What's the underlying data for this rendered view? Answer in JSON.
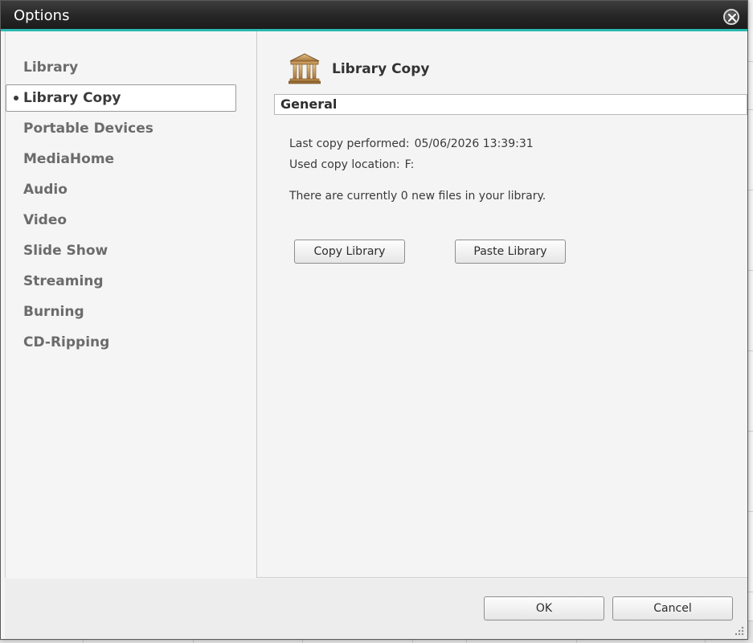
{
  "window": {
    "title": "Options"
  },
  "sidebar": {
    "items": [
      {
        "label": "Library",
        "selected": false
      },
      {
        "label": "Library Copy",
        "selected": true
      },
      {
        "label": "Portable Devices",
        "selected": false
      },
      {
        "label": "MediaHome",
        "selected": false
      },
      {
        "label": "Audio",
        "selected": false
      },
      {
        "label": "Video",
        "selected": false
      },
      {
        "label": "Slide Show",
        "selected": false
      },
      {
        "label": "Streaming",
        "selected": false
      },
      {
        "label": "Burning",
        "selected": false
      },
      {
        "label": "CD-Ripping",
        "selected": false
      }
    ]
  },
  "pane": {
    "icon": "library-building-icon",
    "title": "Library Copy",
    "section_header": "General",
    "last_copy_label": "Last copy performed:",
    "last_copy_value": "05/06/2026 13:39:31",
    "location_label": "Used copy location:",
    "location_value": "F:",
    "new_files_text": "There are currently 0 new files in your library.",
    "copy_button": "Copy Library",
    "paste_button": "Paste Library"
  },
  "footer": {
    "ok_button": "OK",
    "cancel_button": "Cancel"
  },
  "colors": {
    "titlebar": "#262626",
    "accent": "#28b8b0",
    "selected_item_text": "#3a3a3a",
    "nav_item_text": "#6b6b6b"
  }
}
